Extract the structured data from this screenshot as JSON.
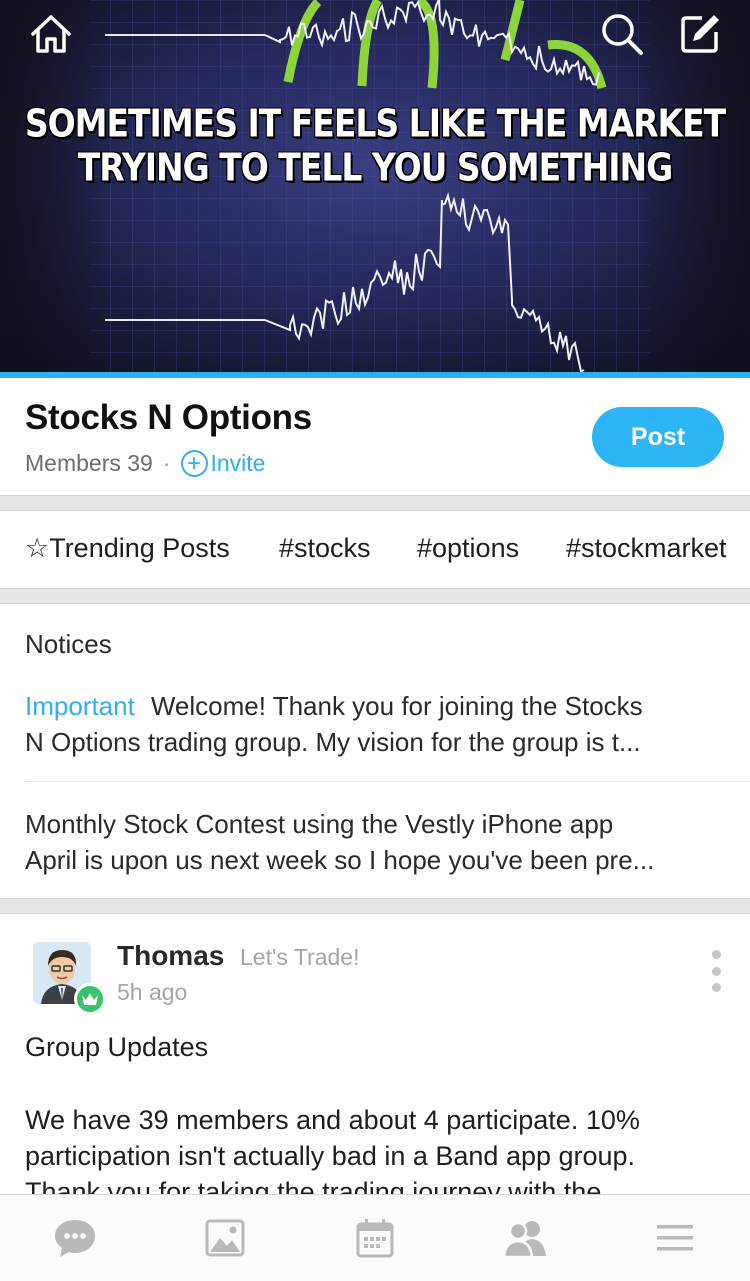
{
  "cover": {
    "line1": "SOMETIMES IT FEELS LIKE THE MARKET",
    "line2": "TRYING TO TELL YOU SOMETHING",
    "icons": [
      "home-icon",
      "search-icon",
      "compose-icon"
    ]
  },
  "group": {
    "name": "Stocks N Options",
    "members": "Members 39",
    "separator": "·",
    "invite_label": "Invite",
    "post_button": "Post"
  },
  "tags": [
    "☆Trending Posts",
    "#stocks",
    "#options",
    "#stockmarket"
  ],
  "notices": {
    "title": "Notices",
    "items": [
      {
        "badge": "Important",
        "line1": "Welcome!  Thank you for joining the Stocks",
        "line2": "N Options trading group. My vision for the group is t..."
      },
      {
        "line1": "Monthly Stock Contest using the Vestly iPhone app",
        "line2": "April is upon us next week so I hope you've been pre..."
      }
    ]
  },
  "post": {
    "author": "Thomas",
    "tagline": "Let's Trade!",
    "time": "5h ago",
    "title": "Group Updates",
    "body_lines": [
      "We have 39 members and about 4 participate. 10%",
      "participation isn't actually bad in a Band app group.",
      "Thank you for taking the trading journey with the"
    ]
  },
  "bottom_nav": [
    "chat-icon",
    "photo-icon",
    "calendar-icon",
    "members-icon",
    "menu-icon"
  ],
  "colors": {
    "accent": "#26b3f0",
    "post_button": "#2eb5f5",
    "crown_badge": "#36c36a",
    "chart_highlight": "#8fd33a"
  }
}
